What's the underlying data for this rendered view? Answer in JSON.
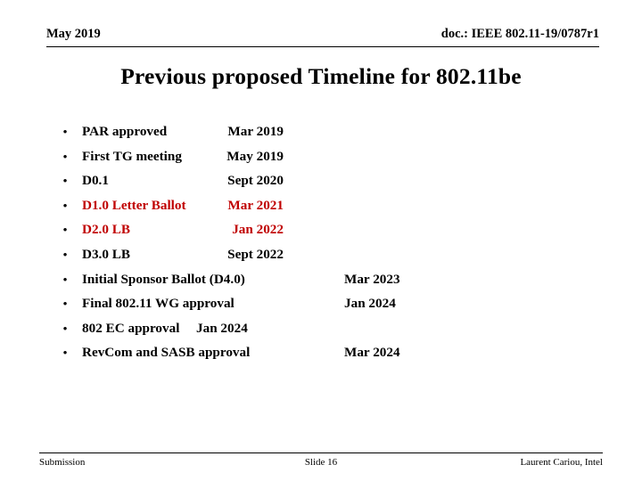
{
  "header": {
    "left": "May 2019",
    "right": "doc.: IEEE 802.11-19/0787r1"
  },
  "title": "Previous proposed Timeline for 802.11be",
  "colors": {
    "text": "#000000",
    "highlight_red": "#C00000",
    "background": "#FFFFFF"
  },
  "bullets": [
    {
      "marker": "•",
      "label": "PAR approved",
      "date": "Mar 2019",
      "date_column": "a",
      "red": false
    },
    {
      "marker": "•",
      "label": "First TG meeting",
      "date": "May 2019",
      "date_column": "a",
      "red": false
    },
    {
      "marker": "•",
      "label": "D0.1",
      "date": "Sept 2020",
      "date_column": "a",
      "red": false
    },
    {
      "marker": "•",
      "label": "D1.0 Letter Ballot",
      "date": "Mar 2021",
      "date_column": "a",
      "red": true
    },
    {
      "marker": "•",
      "label": "D2.0 LB",
      "date": "Jan 2022",
      "date_column": "a",
      "red": true
    },
    {
      "marker": "•",
      "label": "D3.0 LB",
      "date": "Sept 2022",
      "date_column": "a",
      "red": false
    },
    {
      "marker": "•",
      "label": "Initial Sponsor Ballot (D4.0)",
      "date": "Mar 2023",
      "date_column": "b",
      "red": false
    },
    {
      "marker": "•",
      "label": "Final 802.11 WG approval",
      "date": "Jan 2024",
      "date_column": "b",
      "red": false
    },
    {
      "marker": "•",
      "label": "802 EC approval",
      "date": "Jan 2024",
      "date_column": "inline",
      "red": false
    },
    {
      "marker": "•",
      "label": "RevCom and SASB approval",
      "date": "Mar 2024",
      "date_column": "b",
      "red": false
    }
  ],
  "footer": {
    "left": "Submission",
    "center": "Slide 16",
    "right": "Laurent Cariou, Intel"
  }
}
